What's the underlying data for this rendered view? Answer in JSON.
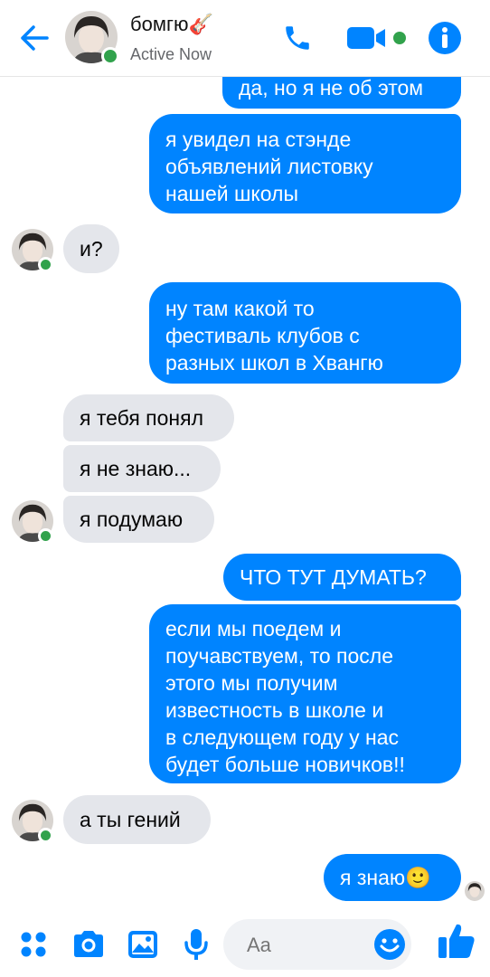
{
  "header": {
    "contact_name": "бомгю🎸",
    "status": "Active Now"
  },
  "messages": [
    {
      "from": "me",
      "text": "да, но я не об этом"
    },
    {
      "from": "me",
      "text": "я увидел на стэнде\nобъявлений листовку\nнашей школы"
    },
    {
      "from": "them",
      "text": "и?"
    },
    {
      "from": "me",
      "text": "ну там какой то\nфестиваль клубов с\nразных школ в Хвангю"
    },
    {
      "from": "them",
      "text": "я тебя понял"
    },
    {
      "from": "them",
      "text": "я не знаю..."
    },
    {
      "from": "them",
      "text": "я подумаю"
    },
    {
      "from": "me",
      "text": "ЧТО ТУТ ДУМАТЬ?"
    },
    {
      "from": "me",
      "text": "если мы поедем и\nпоучавствуем, то после\nэтого мы получим\nизвестность в школе и\nв следующем году у нас\nбудет больше новичков!!"
    },
    {
      "from": "them",
      "text": "а ты гений"
    },
    {
      "from": "me",
      "text": "я знаю🙂"
    }
  ],
  "composer": {
    "placeholder": "Aa"
  },
  "colors": {
    "accent": "#0084ff",
    "incoming_bubble": "#e4e6eb",
    "online": "#31a24c"
  },
  "icons": [
    "back-arrow-icon",
    "phone-icon",
    "video-camera-icon",
    "info-icon",
    "apps-icon",
    "camera-icon",
    "gallery-icon",
    "microphone-icon",
    "emoji-icon",
    "thumbs-up-icon"
  ]
}
